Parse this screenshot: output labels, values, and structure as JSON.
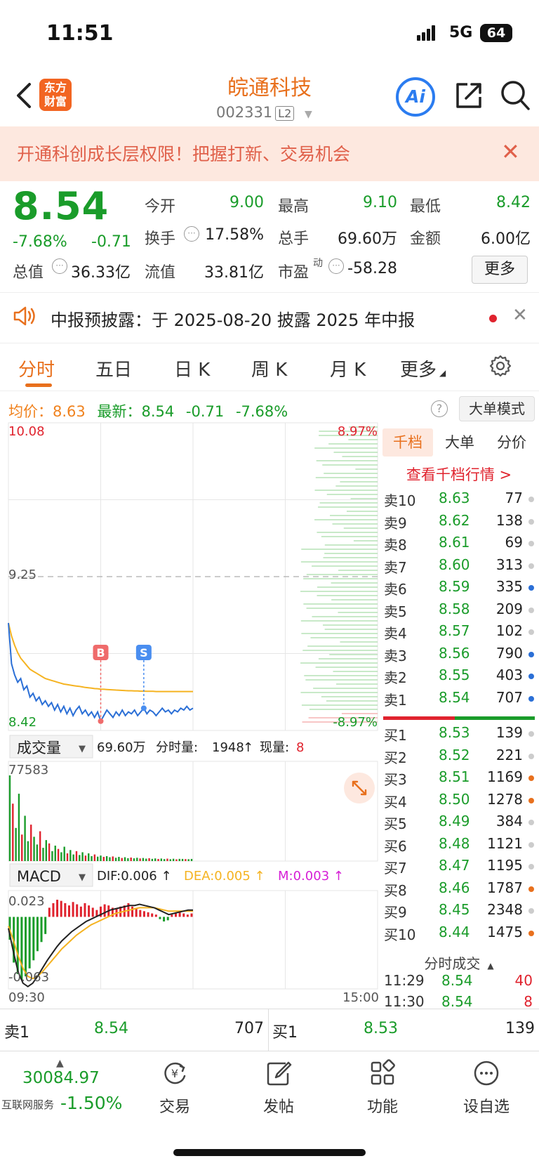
{
  "status_bar": {
    "time": "11:51",
    "network": "5G",
    "battery": "64"
  },
  "header": {
    "logo_line1": "东方",
    "logo_line2": "财富",
    "stock_name": "皖通科技",
    "stock_code": "002331",
    "level_badge": "L2",
    "ai_label": "Ai"
  },
  "banner": {
    "text": "开通科创成长层权限！把握打新、交易机会",
    "close": "✕"
  },
  "quote": {
    "price": "8.54",
    "change_pct": "-7.68%",
    "change": "-0.71",
    "open_label": "今开",
    "open": "9.00",
    "high_label": "最高",
    "high": "9.10",
    "low_label": "最低",
    "low": "8.42",
    "turnover_label": "换手",
    "turnover": "17.58%",
    "volume_label": "总手",
    "volume": "69.60万",
    "amount_label": "金额",
    "amount": "6.00亿",
    "mcap_label": "总值",
    "mcap": "36.33亿",
    "float_label": "流值",
    "float": "33.81亿",
    "pe_label": "市盈",
    "pe_sup": "动",
    "pe": "-58.28",
    "more": "更多"
  },
  "notice": {
    "text": "中报预披露：于 2025-08-20 披露 2025 年中报",
    "close": "✕"
  },
  "tabs": [
    "分时",
    "五日",
    "日 K",
    "周 K",
    "月 K",
    "更多"
  ],
  "info_line": {
    "avg_label": "均价：",
    "avg": "8.63",
    "latest_label": "最新：",
    "latest": "8.54",
    "change": "-0.71",
    "change_pct": "-7.68%",
    "mode_button": "大单模式"
  },
  "chart_data": {
    "type": "line",
    "title": "",
    "y_top_label": "10.08",
    "y_mid_label": "9.25",
    "y_bottom_label": "8.42",
    "pct_top_label": "8.97%",
    "pct_bottom_label": "-8.97%",
    "x_start_label": "09:30",
    "x_end_label": "15:00",
    "ylim": [
      8.42,
      10.08
    ],
    "prev_close": 9.25,
    "price_series_name": "最新",
    "avg_series_name": "均价",
    "price": [
      9.0,
      8.78,
      8.72,
      8.68,
      8.7,
      8.64,
      8.66,
      8.6,
      8.62,
      8.58,
      8.6,
      8.56,
      8.58,
      8.55,
      8.57,
      8.53,
      8.56,
      8.52,
      8.55,
      8.51,
      8.54,
      8.5,
      8.53,
      8.55,
      8.51,
      8.53,
      8.5,
      8.52,
      8.49,
      8.52,
      8.47,
      8.5,
      8.53,
      8.51,
      8.49,
      8.52,
      8.5,
      8.53,
      8.5,
      8.52,
      8.51,
      8.53,
      8.5,
      8.52,
      8.54,
      8.51,
      8.53,
      8.52,
      8.5,
      8.52,
      8.54,
      8.52,
      8.53,
      8.51,
      8.53,
      8.52,
      8.54,
      8.53,
      8.55,
      8.53,
      8.54
    ],
    "avg": [
      9.0,
      8.93,
      8.88,
      8.84,
      8.81,
      8.79,
      8.77,
      8.75,
      8.74,
      8.73,
      8.72,
      8.71,
      8.7,
      8.695,
      8.69,
      8.685,
      8.68,
      8.675,
      8.67,
      8.668,
      8.665,
      8.662,
      8.66,
      8.658,
      8.655,
      8.652,
      8.65,
      8.648,
      8.646,
      8.645,
      8.643,
      8.642,
      8.641,
      8.64,
      8.639,
      8.638,
      8.637,
      8.636,
      8.635,
      8.634,
      8.634,
      8.633,
      8.633,
      8.632,
      8.632,
      8.631,
      8.631,
      8.631,
      8.63,
      8.63,
      8.63,
      8.63,
      8.63,
      8.63,
      8.63,
      8.63,
      8.63,
      8.63,
      8.63,
      8.63,
      8.63
    ],
    "markers": [
      {
        "label": "B",
        "color": "#ef6b6b"
      },
      {
        "label": "S",
        "color": "#4a8ef0"
      }
    ],
    "volume": {
      "label": "成交量",
      "total": "69.60万",
      "interval_label": "分时量:",
      "interval": "1948",
      "current_label": "现量:",
      "current": "8",
      "max_label": "77583",
      "max": 77583,
      "bars": [
        77583,
        52000,
        30000,
        61000,
        24000,
        41000,
        18000,
        33000,
        22000,
        15000,
        27000,
        12000,
        19000,
        16000,
        9000,
        14000,
        11000,
        8000,
        13000,
        7000,
        10000,
        6000,
        9000,
        5500,
        8000,
        5000,
        7000,
        4500,
        6000,
        4000,
        5000,
        3800,
        4500,
        3500,
        4200,
        3000,
        3800,
        2800,
        3500,
        2600,
        3200,
        2500,
        3000,
        2400,
        2800,
        2200,
        2600,
        2000,
        2400,
        1900,
        2300,
        1800,
        2200,
        1700,
        2100,
        1600,
        2000,
        1948,
        1800,
        1700,
        1948
      ]
    },
    "macd": {
      "label": "MACD",
      "dif_label": "DIF:",
      "dif": "0.006",
      "dea_label": "DEA:",
      "dea": "0.005",
      "m_label": "M:",
      "m": "0.003",
      "top_label": "0.023",
      "bottom_label": "-0.063",
      "ylim": [
        -0.063,
        0.023
      ],
      "hist": [
        -0.02,
        -0.04,
        -0.05,
        -0.055,
        -0.052,
        -0.045,
        -0.038,
        -0.03,
        -0.022,
        -0.015,
        0.008,
        0.012,
        0.015,
        0.014,
        0.012,
        0.01,
        0.013,
        0.011,
        0.009,
        0.012,
        0.01,
        0.008,
        0.006,
        0.009,
        0.011,
        0.01,
        0.008,
        0.007,
        0.009,
        0.01,
        0.012,
        0.009,
        0.007,
        0.006,
        0.005,
        0.004,
        0.003,
        0.002,
        -0.002,
        -0.004,
        -0.003,
        0.002,
        0.003,
        0.004,
        0.003,
        0.002,
        0.003
      ],
      "dif_line": [
        -0.01,
        -0.03,
        -0.048,
        -0.058,
        -0.061,
        -0.058,
        -0.052,
        -0.045,
        -0.038,
        -0.032,
        -0.026,
        -0.021,
        -0.017,
        -0.013,
        -0.01,
        -0.007,
        -0.004,
        -0.002,
        0.0,
        0.002,
        0.004,
        0.006,
        0.007,
        0.008,
        0.009,
        0.01,
        0.01,
        0.011,
        0.01,
        0.009,
        0.008,
        0.006,
        0.004,
        0.002,
        0.003,
        0.004,
        0.005,
        0.006,
        0.006
      ],
      "dea_line": [
        -0.008,
        -0.02,
        -0.034,
        -0.045,
        -0.052,
        -0.054,
        -0.052,
        -0.048,
        -0.043,
        -0.038,
        -0.033,
        -0.028,
        -0.024,
        -0.02,
        -0.016,
        -0.013,
        -0.01,
        -0.007,
        -0.005,
        -0.003,
        -0.001,
        0.001,
        0.003,
        0.004,
        0.005,
        0.006,
        0.007,
        0.008,
        0.008,
        0.008,
        0.008,
        0.007,
        0.006,
        0.005,
        0.005,
        0.005,
        0.005,
        0.005,
        0.005
      ]
    }
  },
  "order_book": {
    "tabs": [
      "千档",
      "大单",
      "分价"
    ],
    "link": "查看千档行情 >",
    "asks": [
      {
        "label": "卖10",
        "price": "8.63",
        "volume": "77",
        "dot": "#cccccc"
      },
      {
        "label": "卖9",
        "price": "8.62",
        "volume": "138",
        "dot": "#cccccc"
      },
      {
        "label": "卖8",
        "price": "8.61",
        "volume": "69",
        "dot": "#cccccc"
      },
      {
        "label": "卖7",
        "price": "8.60",
        "volume": "313",
        "dot": "#cccccc"
      },
      {
        "label": "卖6",
        "price": "8.59",
        "volume": "335",
        "dot": "#2b6fd6"
      },
      {
        "label": "卖5",
        "price": "8.58",
        "volume": "209",
        "dot": "#cccccc"
      },
      {
        "label": "卖4",
        "price": "8.57",
        "volume": "102",
        "dot": "#cccccc"
      },
      {
        "label": "卖3",
        "price": "8.56",
        "volume": "790",
        "dot": "#2b6fd6"
      },
      {
        "label": "卖2",
        "price": "8.55",
        "volume": "403",
        "dot": "#2b6fd6"
      },
      {
        "label": "卖1",
        "price": "8.54",
        "volume": "707",
        "dot": "#2b6fd6"
      }
    ],
    "bids": [
      {
        "label": "买1",
        "price": "8.53",
        "volume": "139",
        "dot": "#cccccc"
      },
      {
        "label": "买2",
        "price": "8.52",
        "volume": "221",
        "dot": "#cccccc"
      },
      {
        "label": "买3",
        "price": "8.51",
        "volume": "1169",
        "dot": "#e8701d"
      },
      {
        "label": "买4",
        "price": "8.50",
        "volume": "1278",
        "dot": "#e8701d"
      },
      {
        "label": "买5",
        "price": "8.49",
        "volume": "384",
        "dot": "#cccccc"
      },
      {
        "label": "买6",
        "price": "8.48",
        "volume": "1121",
        "dot": "#cccccc"
      },
      {
        "label": "买7",
        "price": "8.47",
        "volume": "1195",
        "dot": "#cccccc"
      },
      {
        "label": "买8",
        "price": "8.46",
        "volume": "1787",
        "dot": "#e8701d"
      },
      {
        "label": "买9",
        "price": "8.45",
        "volume": "2348",
        "dot": "#cccccc"
      },
      {
        "label": "买10",
        "price": "8.44",
        "volume": "1475",
        "dot": "#e8701d"
      }
    ],
    "ticks_header": "分时成交",
    "ticks": [
      {
        "time": "11:29",
        "price": "8.54",
        "volume": "40"
      },
      {
        "time": "11:30",
        "price": "8.54",
        "volume": "8"
      }
    ]
  },
  "bottom_quote": {
    "ask_label": "卖1",
    "ask_price": "8.54",
    "ask_volume": "707",
    "bid_label": "买1",
    "bid_price": "8.53",
    "bid_volume": "139"
  },
  "bottom_nav": {
    "index_value": "30084.97",
    "index_name": "互联网服务",
    "index_pct": "-1.50%",
    "items": [
      "交易",
      "发帖",
      "功能",
      "设自选"
    ]
  },
  "colors": {
    "up": "#e0232e",
    "down": "#1a9c2a",
    "accent": "#e8701d",
    "avg_line": "#f5b321",
    "price_line": "#2b6fd6"
  }
}
